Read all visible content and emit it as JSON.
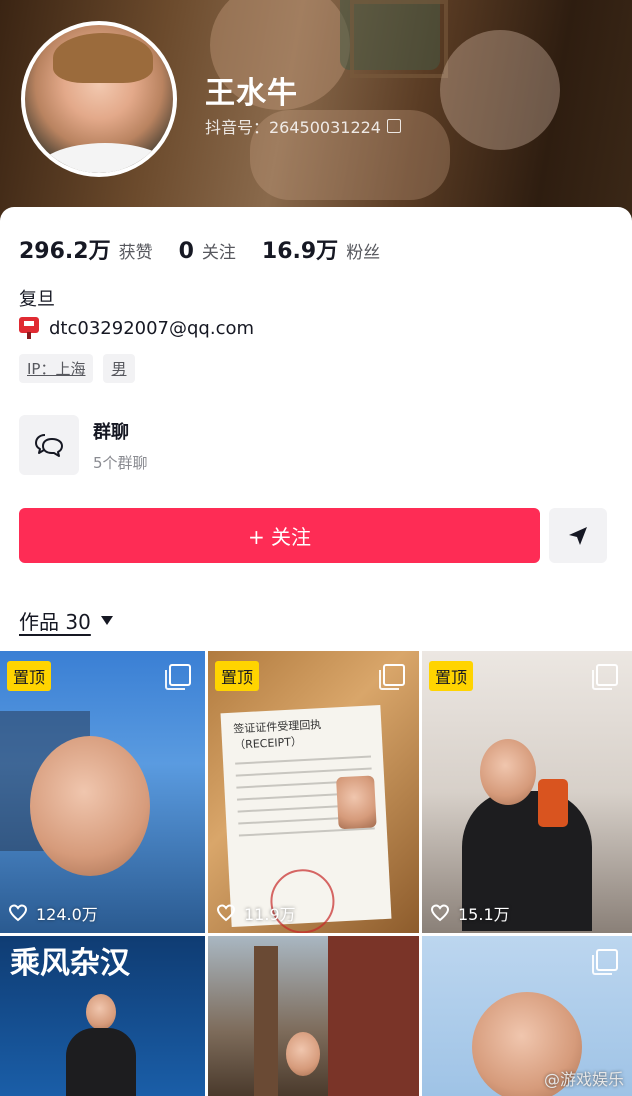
{
  "profile": {
    "name": "王水牛",
    "douyin_id": "抖音号：26450031224"
  },
  "stats": [
    {
      "value": "296.2万",
      "label": "获赞"
    },
    {
      "value": "0",
      "label": "关注"
    },
    {
      "value": "16.9万",
      "label": "粉丝"
    }
  ],
  "bio": {
    "school": "复旦",
    "email": "dtc03292007@qq.com",
    "tags": [
      "IP：上海",
      "男"
    ]
  },
  "group_chat": {
    "title": "群聊",
    "subtitle": "5个群聊"
  },
  "actions": {
    "follow_label": "+ 关注"
  },
  "works": {
    "tab_label": "作品 30",
    "pinned_label": "置顶",
    "items": [
      {
        "likes": "124.0万",
        "pinned": true
      },
      {
        "likes": "11.9万",
        "pinned": true,
        "doc_title": "签证证件受理回执（RECEIPT）"
      },
      {
        "likes": "15.1万",
        "pinned": true
      },
      {
        "likes": "",
        "pinned": false,
        "banner_text": "乘风杂汉"
      },
      {
        "likes": "",
        "pinned": false
      },
      {
        "likes": "",
        "pinned": false
      }
    ]
  },
  "watermark": "@游戏娱乐",
  "colors": {
    "accent": "#fe2c55",
    "pin_badge": "#ffd400"
  }
}
